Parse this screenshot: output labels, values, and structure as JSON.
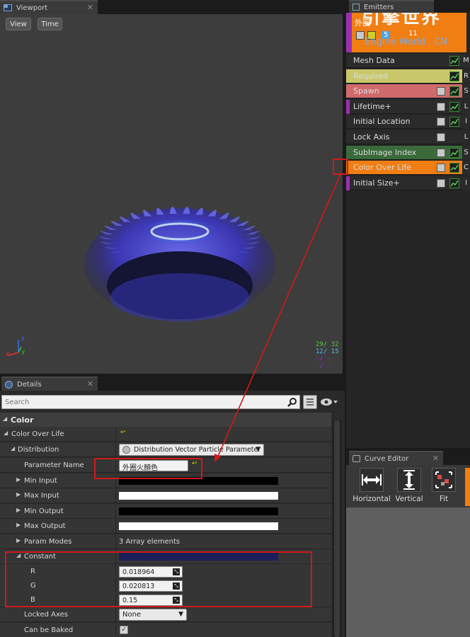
{
  "viewport": {
    "tab_label": "Viewport",
    "buttons": [
      "View",
      "Time"
    ],
    "stats": {
      "line1": "29/  32",
      "line2": "12/  15",
      "line3": "  -/  -",
      "line4": "  -/  -"
    },
    "axis_labels": {
      "z": "z",
      "x": "x",
      "y": "y"
    }
  },
  "emitters": {
    "tab_label": "Emitters",
    "emitter_name": "外圈",
    "emitter_stats": {
      "a": "5",
      "b": "11"
    },
    "watermark": {
      "title": "引擎世界",
      "subtitle": "Engine World . CN"
    },
    "modules": [
      {
        "label": "Mesh Data",
        "bg": "#2b2b2b",
        "checkbox": false,
        "graph": true,
        "side": "M",
        "purple": false
      },
      {
        "label": "Required",
        "bg": "#c8c86a",
        "checkbox": false,
        "graph": true,
        "side": "R",
        "purple": false
      },
      {
        "label": "Spawn",
        "bg": "#d06a6a",
        "checkbox": true,
        "graph": true,
        "side": "S",
        "purple": false
      },
      {
        "label": "Lifetime+",
        "bg": "#2b2b2b",
        "checkbox": true,
        "graph": true,
        "side": "L",
        "purple": true
      },
      {
        "label": "Initial Location",
        "bg": "#2b2b2b",
        "checkbox": true,
        "graph": true,
        "side": "I",
        "purple": false
      },
      {
        "label": "Lock Axis",
        "bg": "#2b2b2b",
        "checkbox": true,
        "graph": false,
        "side": "L",
        "purple": false
      },
      {
        "label": "SubImage Index",
        "bg": "#3a6a3a",
        "checkbox": true,
        "graph": true,
        "side": "S",
        "purple": false
      },
      {
        "label": "Color Over Life",
        "bg": "#f07e12",
        "checkbox": true,
        "graph": true,
        "side": "C",
        "purple": false
      },
      {
        "label": "Initial Size+",
        "bg": "#2b2b2b",
        "checkbox": true,
        "graph": true,
        "side": "I",
        "purple": true
      }
    ]
  },
  "curve_editor": {
    "tab_label": "Curve Editor",
    "buttons": [
      "Horizontal",
      "Vertical",
      "Fit"
    ]
  },
  "details": {
    "tab_label": "Details",
    "search_placeholder": "Search",
    "category": "Color",
    "color_over_life": "Color Over Life",
    "distribution_label": "Distribution",
    "distribution_value": "Distribution Vector Particle Parameter",
    "parameter_name_label": "Parameter Name",
    "parameter_name_value": "外圈火顏色",
    "min_input": "Min Input",
    "max_input": "Max Input",
    "min_output": "Min Output",
    "max_output": "Max Output",
    "param_modes": "Param Modes",
    "param_modes_value": "3 Array elements",
    "constant": "Constant",
    "constant_color": "#1c1e5a",
    "r_label": "R",
    "r_value": "0.018964",
    "g_label": "G",
    "g_value": "0.020813",
    "b_label": "B",
    "b_value": "0.15",
    "locked_axes": "Locked Axes",
    "locked_axes_value": "None",
    "can_be_baked": "Can be Baked"
  },
  "annotation_color": "#d11a1a"
}
